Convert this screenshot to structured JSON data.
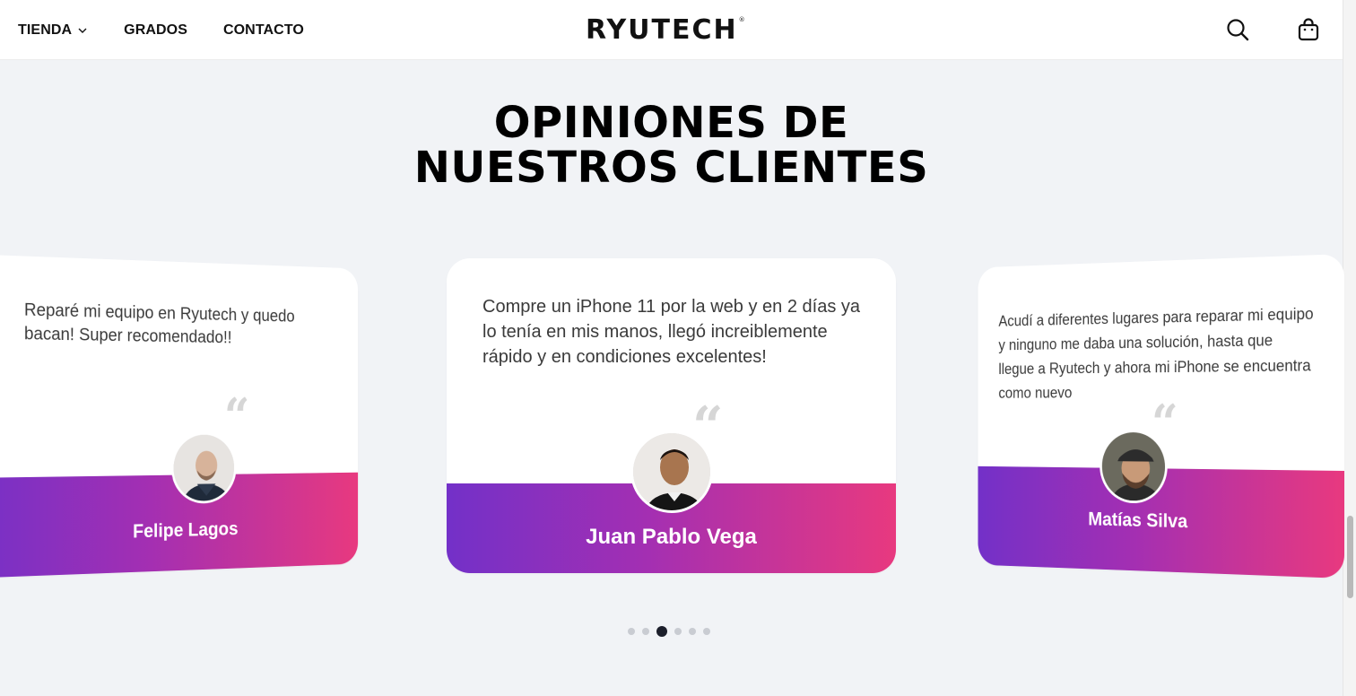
{
  "header": {
    "nav": [
      {
        "label": "TIENDA",
        "has_dropdown": true
      },
      {
        "label": "GRADOS"
      },
      {
        "label": "CONTACTO"
      }
    ],
    "logo": "RYUTECH",
    "logo_mark": "®",
    "icons": [
      "search-icon",
      "shopping-bag-icon"
    ]
  },
  "section": {
    "title_line1": "OPINIONES DE",
    "title_line2": "NUESTROS CLIENTES"
  },
  "testimonials": [
    {
      "text": "Reparé mi equipo en Ryutech y quedo bacan! Super recomendado!!",
      "name": "Felipe Lagos"
    },
    {
      "text": "Compre un iPhone 11 por la web y en 2 días ya lo tenía en mis manos, llegó increiblemente rápido y en condiciones excelentes!",
      "name": "Juan Pablo Vega"
    },
    {
      "text": "Acudí a diferentes lugares para reparar mi equipo y ninguno me daba una solución, hasta que llegue a Ryutech y ahora mi iPhone se encuentra como nuevo",
      "name": "Matías Silva"
    }
  ],
  "carousel": {
    "total_slides": 6,
    "active_index": 2
  },
  "colors": {
    "background": "#f1f3f6",
    "gradient_start": "#7330c8",
    "gradient_end": "#e8397f",
    "dot_active": "#1c1f2b",
    "dot_inactive": "#c9ccd2"
  }
}
